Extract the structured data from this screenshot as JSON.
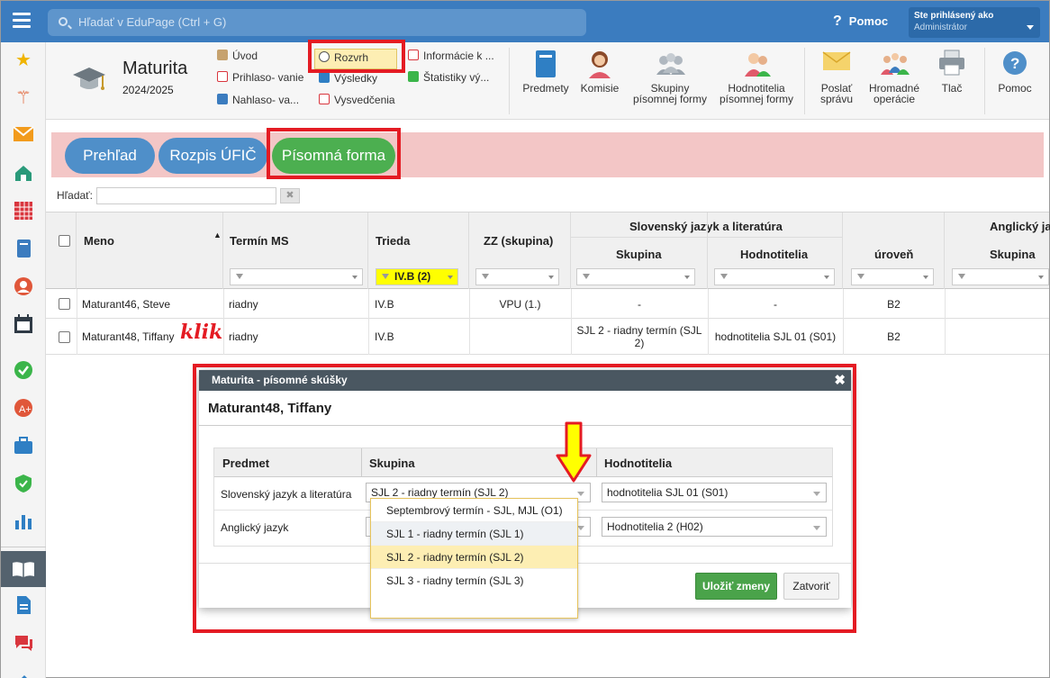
{
  "topbar": {
    "search_placeholder": "Hľadať v EduPage (Ctrl + G)",
    "help_label": "Pomoc",
    "user_line1": "Ste prihlásený ako",
    "user_line2": "Administrátor"
  },
  "module": {
    "title": "Maturita",
    "year": "2024/2025"
  },
  "menu": {
    "uvod": "Úvod",
    "prihlasovanie": "Prihlaso- vanie",
    "nahlasovanie": "Nahlaso- va...",
    "rozvrh": "Rozvrh",
    "vysledky": "Výsledky",
    "vysvedcenia": "Vysvedčenia",
    "informacie": "Informácie k ...",
    "statistiky": "Štatistiky vý..."
  },
  "toolbar_buttons": {
    "predmety": "Predmety",
    "komisie": "Komisie",
    "skupiny_l1": "Skupiny",
    "skupiny_l2": "písomnej formy",
    "hodnotitelia_l1": "Hodnotitelia",
    "hodnotitelia_l2": "písomnej formy",
    "poslat_l1": "Poslať",
    "poslat_l2": "správu",
    "hromadne_l1": "Hromadné",
    "hromadne_l2": "operácie",
    "tlac": "Tlač",
    "pomoc": "Pomoc"
  },
  "tabs": {
    "prehlad": "Prehľad",
    "rozpis": "Rozpis ÚFIČ",
    "pisomna": "Písomná forma"
  },
  "filter_search": {
    "label": "Hľadať:"
  },
  "grid": {
    "headers": {
      "meno": "Meno",
      "termin": "Termín MS",
      "trieda": "Trieda",
      "zz": "ZZ (skupina)",
      "sjl_group": "Slovenský jazyk a literatúra",
      "skupina": "Skupina",
      "hodnotitelia": "Hodnotitelia",
      "uroven": "úroveň",
      "aj_group": "Anglický ja",
      "aj_skupina": "Skupina"
    },
    "trieda_filter": "IV.B (2)",
    "rows": [
      {
        "meno": "Maturant46, Steve",
        "termin": "riadny",
        "trieda": "IV.B",
        "zz": "VPU (1.)",
        "skupina": "-",
        "hodnotitelia": "-",
        "uroven": "B2"
      },
      {
        "meno": "Maturant48, Tiffany",
        "termin": "riadny",
        "trieda": "IV.B",
        "zz": "",
        "skupina": "SJL 2 - riadny termín (SJL 2)",
        "hodnotitelia": "hodnotitelia SJL 01 (S01)",
        "uroven": "B2"
      }
    ]
  },
  "annotation": {
    "klik": "klik"
  },
  "dialog": {
    "title": "Maturita - písomné skúšky",
    "student": "Maturant48, Tiffany",
    "col_predmet": "Predmet",
    "col_skupina": "Skupina",
    "col_hodnotitelia": "Hodnotitelia",
    "rows": [
      {
        "predmet": "Slovenský jazyk a literatúra",
        "skupina": "SJL 2 - riadny termín (SJL 2)",
        "hodnotitelia": "hodnotitelia SJL 01 (S01)"
      },
      {
        "predmet": "Anglický jazyk",
        "skupina": "",
        "hodnotitelia": "Hodnotitelia 2 (H02)"
      }
    ],
    "dropdown_options": [
      "Septembrový termín - SJL, MJL (O1)",
      "SJL 1 - riadny termín (SJL 1)",
      "SJL 2 - riadny termín (SJL 2)",
      "SJL 3 - riadny termín (SJL 3)"
    ],
    "save_label": "Uložiť zmeny",
    "close_label": "Zatvoriť"
  },
  "colors": {
    "topbar": "#3b7cbf",
    "tab_blue": "#4f8fc9",
    "tab_green": "#4caf50",
    "highlight_red": "#e41b23",
    "dropdown_selected": "#fdeeb3"
  }
}
